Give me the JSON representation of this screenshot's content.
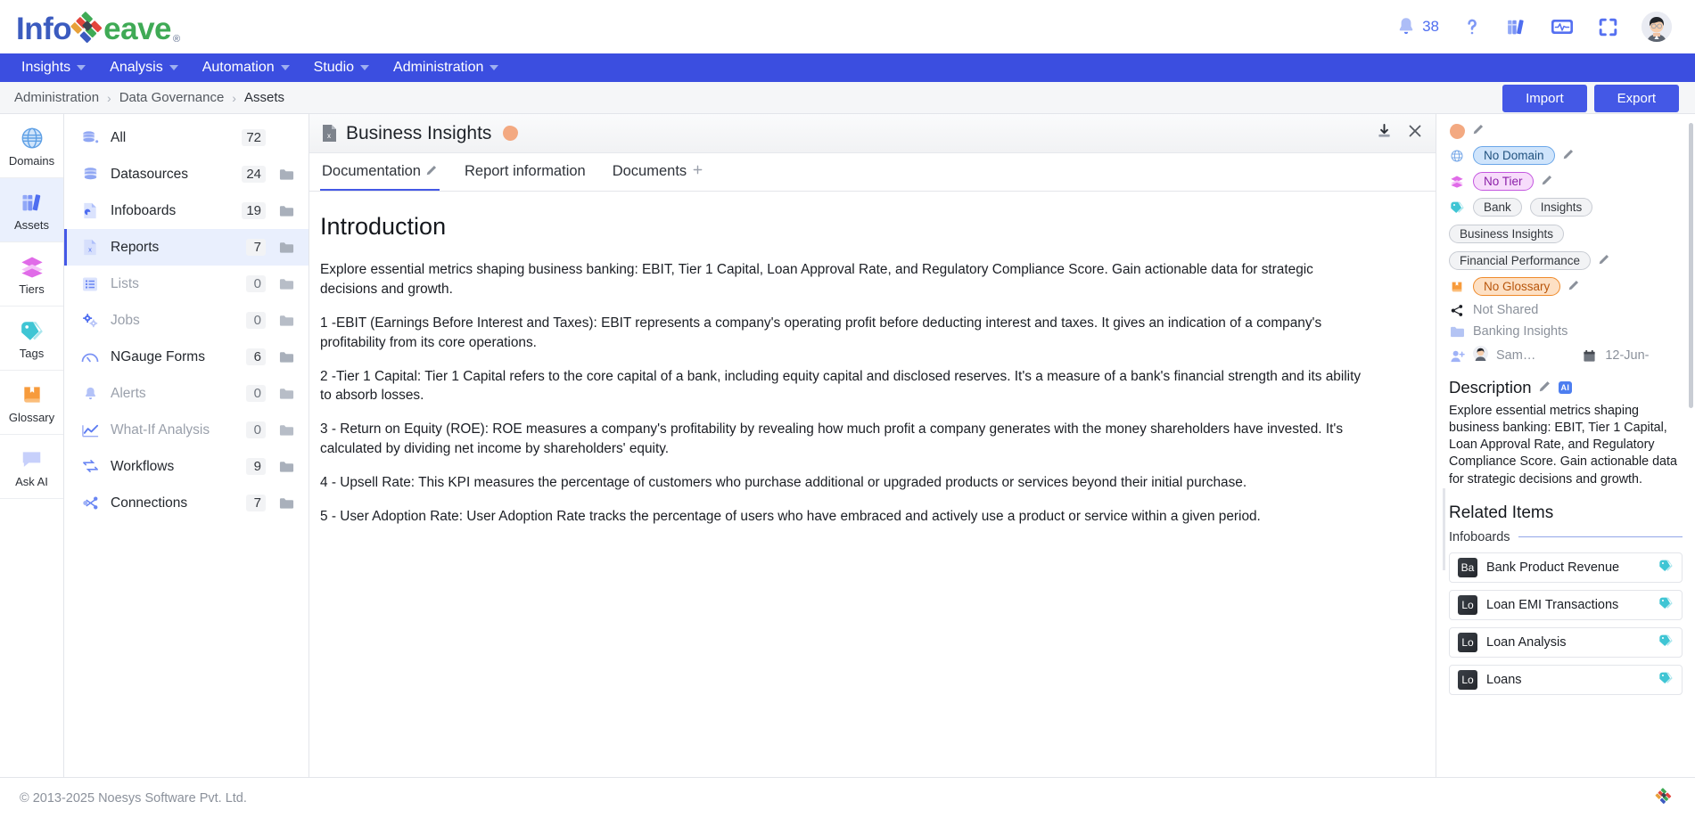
{
  "brand": {
    "name_part1": "Info",
    "name_part2": "eave",
    "registered": "®"
  },
  "topbar": {
    "notifications_count": "38",
    "icons": [
      "bell-icon",
      "help-icon",
      "library-icon",
      "monitor-icon",
      "fullscreen-icon",
      "avatar"
    ]
  },
  "nav": {
    "items": [
      {
        "label": "Insights"
      },
      {
        "label": "Analysis"
      },
      {
        "label": "Automation"
      },
      {
        "label": "Studio"
      },
      {
        "label": "Administration"
      }
    ]
  },
  "breadcrumb": {
    "items": [
      "Administration",
      "Data Governance",
      "Assets"
    ],
    "separator": "›"
  },
  "actions": {
    "import_label": "Import",
    "export_label": "Export"
  },
  "rail": {
    "items": [
      {
        "label": "Domains",
        "icon": "globe-icon",
        "active": false
      },
      {
        "label": "Assets",
        "icon": "books-icon",
        "active": true
      },
      {
        "label": "Tiers",
        "icon": "layers-icon",
        "active": false
      },
      {
        "label": "Tags",
        "icon": "tag-icon",
        "active": false
      },
      {
        "label": "Glossary",
        "icon": "book-icon",
        "active": false
      },
      {
        "label": "Ask AI",
        "icon": "chat-icon",
        "active": false
      }
    ]
  },
  "asset_list": {
    "items": [
      {
        "label": "All",
        "count": "72",
        "icon": "database-all-icon",
        "folder": false,
        "dim": false,
        "active": false
      },
      {
        "label": "Datasources",
        "count": "24",
        "icon": "database-icon",
        "folder": true,
        "dim": false,
        "active": false
      },
      {
        "label": "Infoboards",
        "count": "19",
        "icon": "infoboard-icon",
        "folder": true,
        "dim": false,
        "active": false
      },
      {
        "label": "Reports",
        "count": "7",
        "icon": "report-icon",
        "folder": true,
        "dim": false,
        "active": true
      },
      {
        "label": "Lists",
        "count": "0",
        "icon": "list-icon",
        "folder": true,
        "dim": true,
        "active": false
      },
      {
        "label": "Jobs",
        "count": "0",
        "icon": "gears-icon",
        "folder": true,
        "dim": true,
        "active": false
      },
      {
        "label": "NGauge Forms",
        "count": "6",
        "icon": "gauge-icon",
        "folder": true,
        "dim": false,
        "active": false
      },
      {
        "label": "Alerts",
        "count": "0",
        "icon": "alert-bell-icon",
        "folder": true,
        "dim": true,
        "active": false
      },
      {
        "label": "What-If Analysis",
        "count": "0",
        "icon": "trend-icon",
        "folder": true,
        "dim": true,
        "active": false
      },
      {
        "label": "Workflows",
        "count": "9",
        "icon": "workflow-icon",
        "folder": true,
        "dim": false,
        "active": false
      },
      {
        "label": "Connections",
        "count": "7",
        "icon": "connection-icon",
        "folder": true,
        "dim": false,
        "active": false
      }
    ]
  },
  "document": {
    "title": "Business Insights",
    "tabs": [
      {
        "label": "Documentation",
        "active": true,
        "suffix": "pencil"
      },
      {
        "label": "Report information",
        "active": false,
        "suffix": ""
      },
      {
        "label": "Documents",
        "active": false,
        "suffix": "plus"
      }
    ],
    "heading": "Introduction",
    "paragraphs": [
      "Explore essential metrics shaping business banking: EBIT, Tier 1 Capital, Loan Approval Rate, and Regulatory Compliance Score. Gain actionable data for strategic decisions and growth.",
      "1 -EBIT (Earnings Before Interest and Taxes): EBIT represents a company's operating profit before deducting interest and taxes. It gives an indication of a company's profitability from its core operations.",
      "2 -Tier 1 Capital: Tier 1 Capital refers to the core capital of a bank, including equity capital and disclosed reserves. It's a measure of a bank's financial strength and its ability to absorb losses.",
      "3 - Return on Equity (ROE): ROE measures a company's profitability by revealing how much profit a company generates with the money shareholders have invested. It's calculated by dividing net income by shareholders' equity.",
      "4 - Upsell Rate: This KPI measures the percentage of customers who purchase additional or upgraded products or services beyond their initial purchase.",
      "5 - User Adoption Rate: User Adoption Rate tracks the percentage of users who have embraced and actively use a product or service within a given period."
    ]
  },
  "details": {
    "domain": "No Domain",
    "tier": "No Tier",
    "tags": [
      "Bank",
      "Insights",
      "Business Insights",
      "Financial Performance"
    ],
    "glossary": "No Glossary",
    "shared": "Not Shared",
    "folder": "Banking Insights",
    "owner": "Sam…",
    "date": "12-Jun-",
    "description_title": "Description",
    "ai_badge": "AI",
    "description": "Explore essential metrics shaping business banking: EBIT, Tier 1 Capital, Loan Approval Rate, and Regulatory Compliance Score. Gain actionable data for strategic decisions and growth.",
    "related_title": "Related Items",
    "related_group": "Infoboards",
    "related_items": [
      {
        "initials": "Ba",
        "name": "Bank Product Revenue"
      },
      {
        "initials": "Lo",
        "name": "Loan EMI Transactions"
      },
      {
        "initials": "Lo",
        "name": "Loan Analysis"
      },
      {
        "initials": "Lo",
        "name": "Loans"
      }
    ]
  },
  "footer": {
    "copyright": "© 2013-2025 Noesys Software Pvt. Ltd."
  },
  "colors": {
    "primary": "#3b4ee0",
    "button": "#4458e6",
    "active_bg": "#e9effd",
    "peach": "#f3a981",
    "teal": "#3fc5d4"
  }
}
